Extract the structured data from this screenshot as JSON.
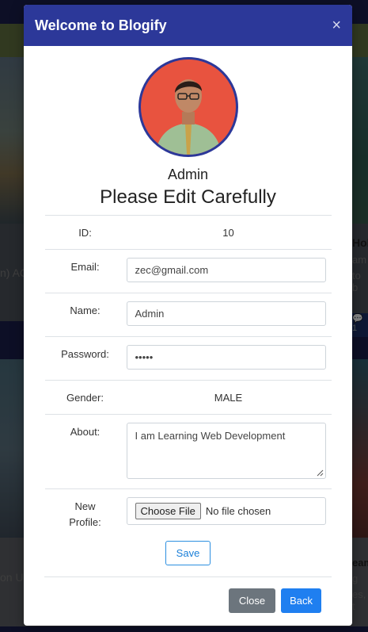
{
  "background": {
    "left_text_1": "n) AC",
    "right_title": "Hol",
    "right_lines_1": [
      "am",
      "to b"
    ],
    "right_chip": "💬 1",
    "left_text_2": "on UX",
    "right_title_2": "eam",
    "right_lines_2": [
      "g",
      "es, t"
    ]
  },
  "modal": {
    "title": "Welcome to Blogify",
    "close_glyph": "×",
    "username": "Admin",
    "headline": "Please Edit Carefully",
    "fields": {
      "id_label": "ID:",
      "id_value": "10",
      "email_label": "Email:",
      "email_value": "zec@gmail.com",
      "name_label": "Name:",
      "name_value": "Admin",
      "password_label": "Password:",
      "password_value": "•••••",
      "gender_label": "Gender:",
      "gender_value": "MALE",
      "about_label": "About:",
      "about_value": "I am Learning Web Development",
      "profile_label_1": "New",
      "profile_label_2": "Profile:",
      "file_button": "Choose File",
      "file_status": "No file chosen"
    },
    "save_label": "Save",
    "close_label": "Close",
    "back_label": "Back"
  },
  "colors": {
    "header_bg": "#2c3899",
    "avatar_bg": "#e8533f",
    "primary": "#1f7ff0",
    "secondary": "#6c757d"
  }
}
